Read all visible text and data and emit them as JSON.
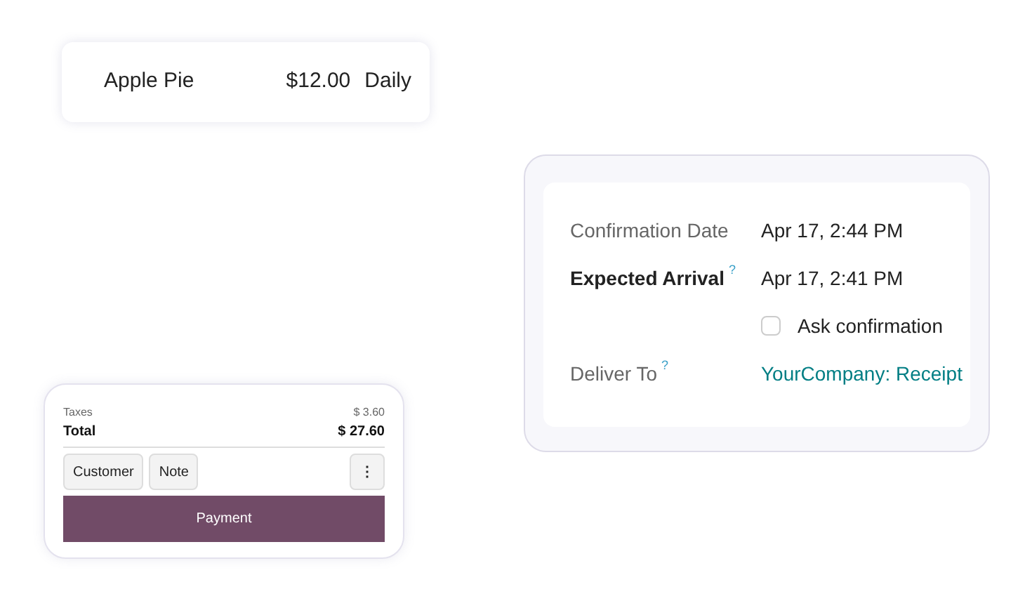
{
  "product": {
    "name": "Apple Pie",
    "price": "$12.00",
    "frequency": "Daily"
  },
  "order": {
    "taxes_label": "Taxes",
    "taxes_value": "$ 3.60",
    "total_label": "Total",
    "total_value": "$ 27.60",
    "buttons": [
      "Customer",
      "Note"
    ],
    "more_button": "⋮",
    "payment_button": "Payment"
  },
  "form": {
    "fields": [
      {
        "kind": "text",
        "label": "Confirmation Date",
        "bold": false,
        "value": "Apr 17, 2:44 PM"
      },
      {
        "kind": "text",
        "label": "Expected Arrival",
        "bold": true,
        "help": "?",
        "value": "Apr 17, 2:41 PM"
      },
      {
        "kind": "checkbox",
        "label": "Ask confirmation",
        "checked": false
      },
      {
        "kind": "link",
        "label": "Deliver To",
        "bold": false,
        "help": "?",
        "value": "YourCompany: Receipt"
      }
    ]
  }
}
